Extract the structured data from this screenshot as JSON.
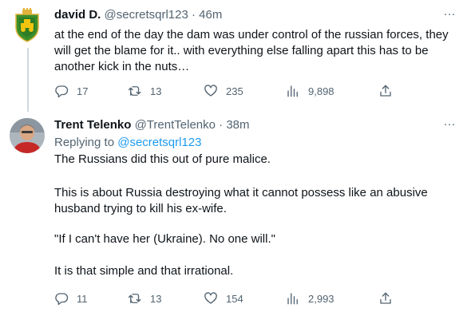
{
  "tweets": [
    {
      "name": "david D.",
      "handle": "@secretsqrl123",
      "sep": "·",
      "time": "46m",
      "more": "···",
      "text": "at the end of the day the dam was under control of the russian forces, they will get the blame for it.. with everything else falling apart this has to be another kick in the nuts…",
      "replies": "17",
      "retweets": "13",
      "likes": "235",
      "views": "9,898"
    },
    {
      "name": "Trent Telenko",
      "handle": "@TrentTelenko",
      "sep": "·",
      "time": "38m",
      "more": "···",
      "replying_label": "Replying to",
      "replying_handle": "@secretsqrl123",
      "paragraphs": [
        "The Russians did this out of pure malice.",
        "This is about Russia destroying what it cannot possess like an abusive husband trying to kill his ex-wife.",
        "\"If I can't have her (Ukraine).  No one will.\"",
        "It is that simple and that irrational."
      ],
      "replies": "11",
      "retweets": "13",
      "likes": "154",
      "views": "2,993"
    }
  ],
  "icons": [
    "reply-icon",
    "retweet-icon",
    "like-icon",
    "views-icon",
    "share-icon",
    "more-icon"
  ],
  "colors": {
    "text": "#0f1419",
    "secondary": "#536471",
    "link": "#1d9bf0",
    "thread": "#cfd9de"
  }
}
